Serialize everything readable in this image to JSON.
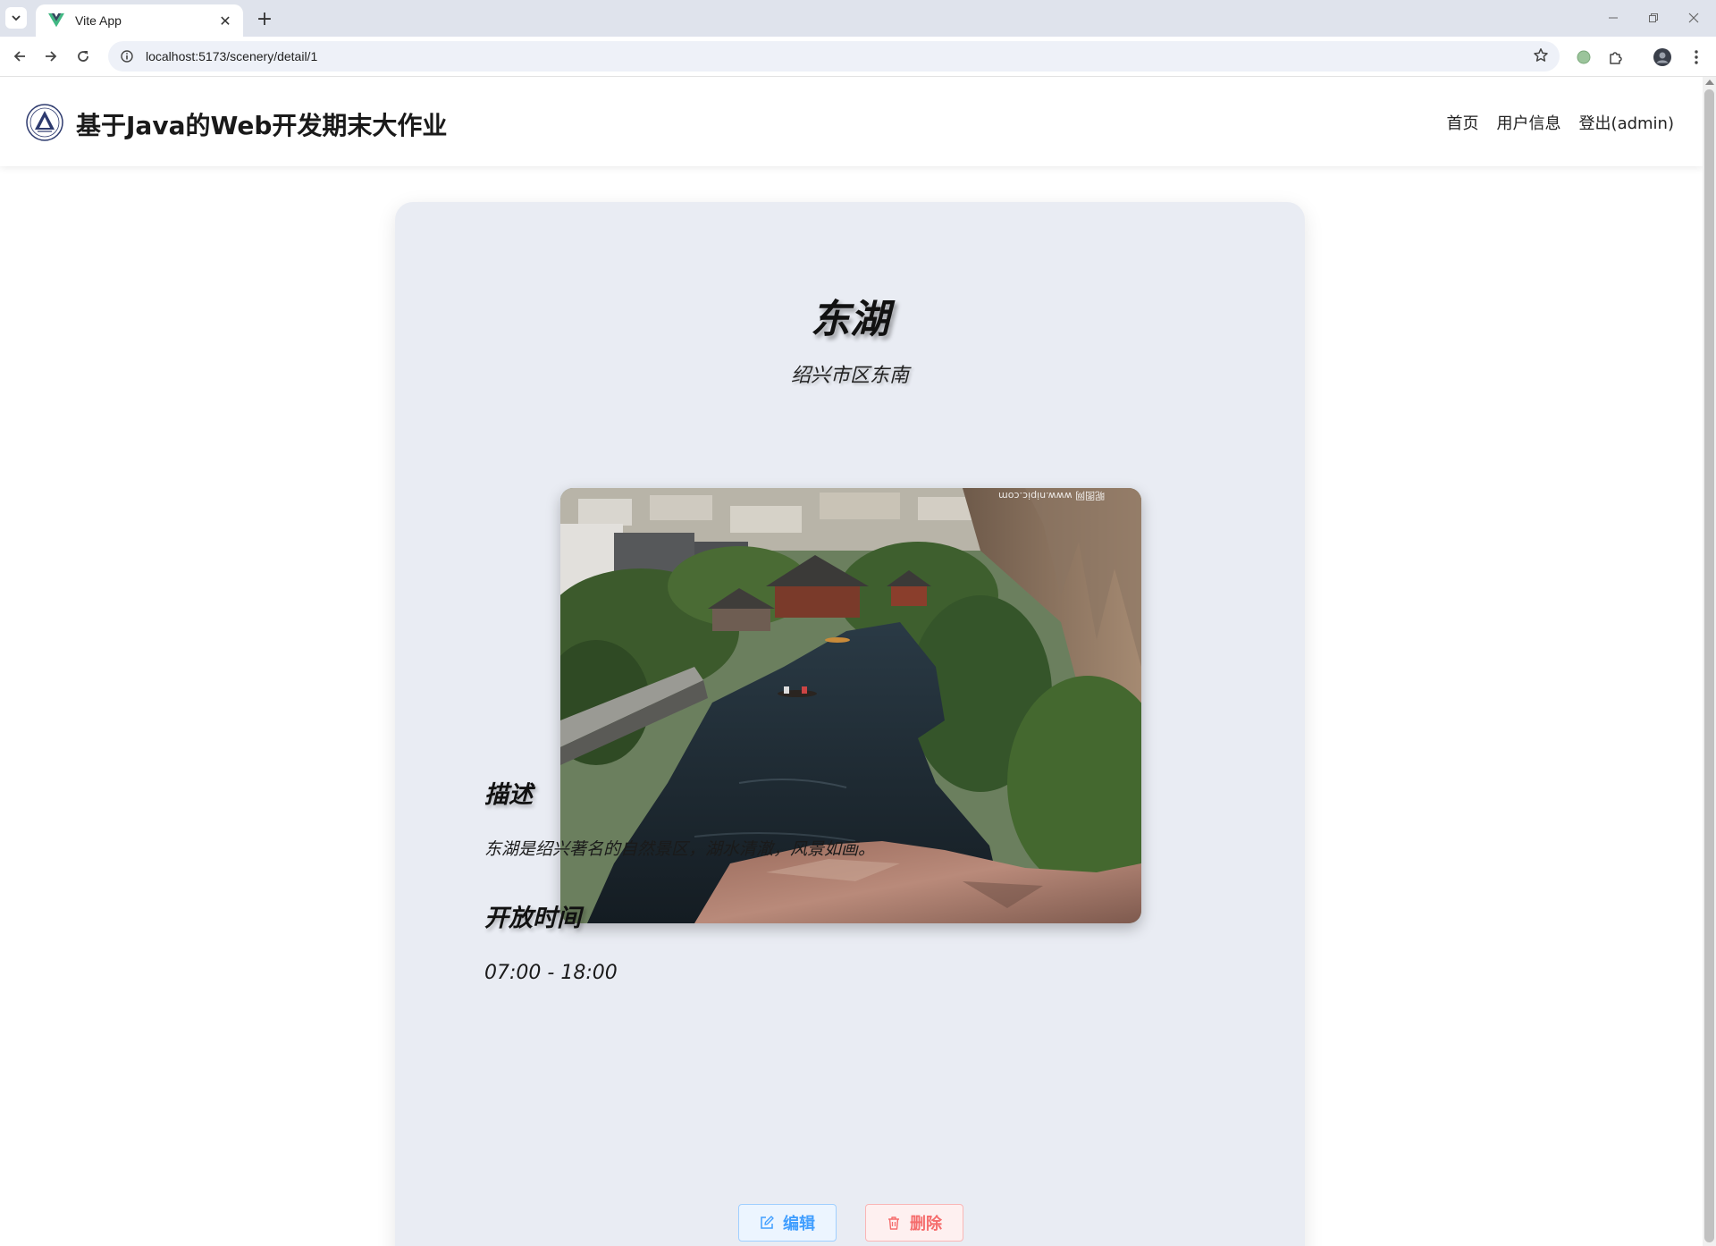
{
  "browser": {
    "tab_title": "Vite App",
    "new_tab_symbol": "+",
    "tab_close_symbol": "✕",
    "url": "localhost:5173/scenery/detail/1"
  },
  "header": {
    "site_title": "基于Java的Web开发期末大作业",
    "nav": [
      "首页",
      "用户信息",
      "登出(admin)"
    ]
  },
  "scenery": {
    "name": "东湖",
    "location": "绍兴市区东南",
    "photo_watermark": "昵图网 www.nipic.com",
    "description_heading": "描述",
    "description": "东湖是绍兴著名的自然景区，湖水清澈，风景如画。",
    "hours_heading": "开放时间",
    "hours": "07:00 - 18:00"
  },
  "actions": {
    "edit_label": "编辑",
    "delete_label": "删除"
  },
  "colors": {
    "primary": "#409eff",
    "danger": "#f56c6c",
    "card_bg": "#e9ecf3"
  }
}
